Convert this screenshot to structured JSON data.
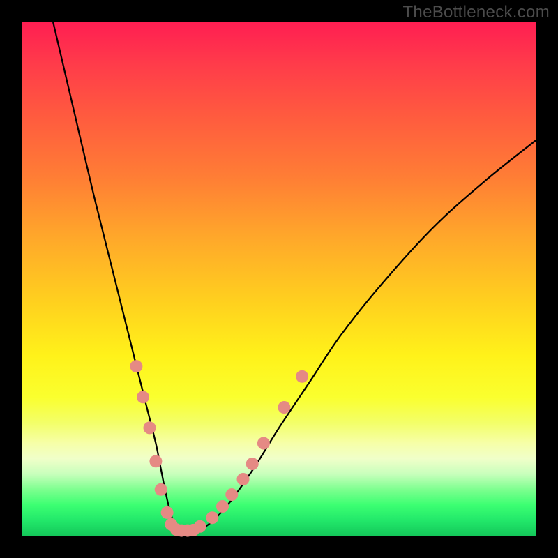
{
  "watermark": "TheBottleneck.com",
  "chart_data": {
    "type": "line",
    "title": "",
    "xlabel": "",
    "ylabel": "",
    "xlim": [
      0,
      100
    ],
    "ylim": [
      0,
      100
    ],
    "grid": false,
    "legend": false,
    "series": [
      {
        "name": "bottleneck-curve",
        "x": [
          6,
          10,
          14,
          18,
          22,
          24,
          26,
          27,
          28,
          29,
          30,
          31,
          33,
          36,
          40,
          45,
          50,
          56,
          62,
          70,
          80,
          90,
          100
        ],
        "values": [
          100,
          83,
          66,
          50,
          34,
          26,
          18,
          13,
          8,
          4,
          1.5,
          1,
          1,
          2,
          6,
          13,
          21,
          30,
          39,
          49,
          60,
          69,
          77
        ]
      }
    ],
    "markers": {
      "color": "#e58a84",
      "radius": 9,
      "points": [
        {
          "x": 22.2,
          "y": 33
        },
        {
          "x": 23.5,
          "y": 27
        },
        {
          "x": 24.8,
          "y": 21
        },
        {
          "x": 26.0,
          "y": 14.5
        },
        {
          "x": 27.0,
          "y": 9
        },
        {
          "x": 28.2,
          "y": 4.5
        },
        {
          "x": 29.0,
          "y": 2.2
        },
        {
          "x": 30.0,
          "y": 1.2
        },
        {
          "x": 31.0,
          "y": 1.0
        },
        {
          "x": 32.2,
          "y": 1.0
        },
        {
          "x": 33.3,
          "y": 1.1
        },
        {
          "x": 34.6,
          "y": 1.8
        },
        {
          "x": 37.0,
          "y": 3.5
        },
        {
          "x": 39.0,
          "y": 5.7
        },
        {
          "x": 40.8,
          "y": 8
        },
        {
          "x": 43.0,
          "y": 11
        },
        {
          "x": 44.8,
          "y": 14
        },
        {
          "x": 47.0,
          "y": 18
        },
        {
          "x": 51.0,
          "y": 25
        },
        {
          "x": 54.5,
          "y": 31
        }
      ]
    },
    "background": {
      "top_color": "#ff1e52",
      "mid_color": "#fff21a",
      "bottom_color": "#14c85a"
    }
  }
}
